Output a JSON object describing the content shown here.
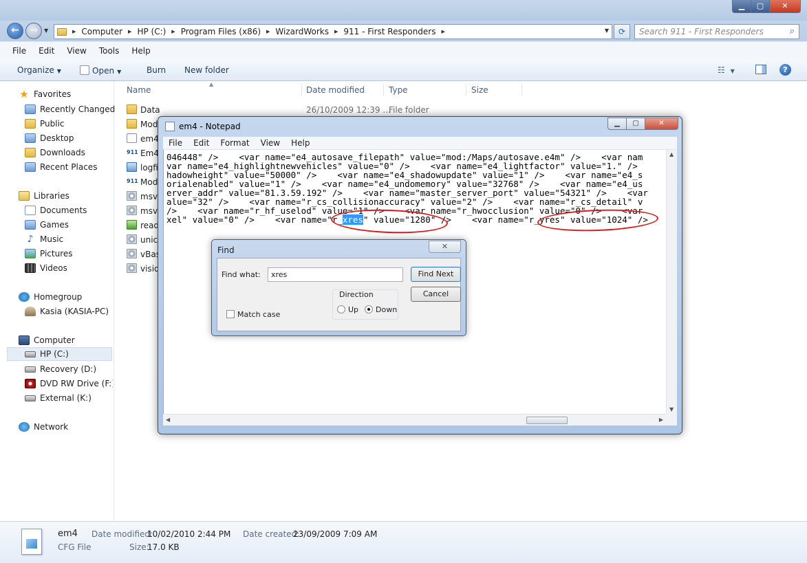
{
  "explorer": {
    "breadcrumbs": [
      "Computer",
      "HP (C:)",
      "Program Files (x86)",
      "WizardWorks",
      "911 - First Responders"
    ],
    "search_placeholder": "Search 911 - First Responders",
    "menu": [
      "File",
      "Edit",
      "View",
      "Tools",
      "Help"
    ],
    "toolbar": {
      "organize": "Organize",
      "open": "Open",
      "burn": "Burn",
      "new_folder": "New folder"
    },
    "nav": {
      "favorites": "Favorites",
      "fav_items": [
        "Recently Changed",
        "Public",
        "Desktop",
        "Downloads",
        "Recent Places"
      ],
      "libraries": "Libraries",
      "lib_items": [
        "Documents",
        "Games",
        "Music",
        "Pictures",
        "Videos"
      ],
      "homegroup": "Homegroup",
      "home_user": "Kasia (KASIA-PC)",
      "computer": "Computer",
      "drives": [
        "HP (C:)",
        "Recovery (D:)",
        "DVD RW Drive (F:) C",
        "External (K:)"
      ],
      "network": "Network"
    },
    "columns": {
      "name": "Name",
      "date": "Date modified",
      "type": "Type",
      "size": "Size"
    },
    "files": [
      {
        "name": "Data",
        "date": "26/10/2009 12:39 ...",
        "type": "File folder"
      },
      {
        "name": "Mod",
        "date": "",
        "type": ""
      },
      {
        "name": "em4",
        "date": "",
        "type": ""
      },
      {
        "name": "Em4",
        "date": "",
        "type": ""
      },
      {
        "name": "logfi",
        "date": "",
        "type": ""
      },
      {
        "name": "Mod",
        "date": "",
        "type": ""
      },
      {
        "name": "msvc",
        "date": "",
        "type": ""
      },
      {
        "name": "msvc",
        "date": "",
        "type": ""
      },
      {
        "name": "read",
        "date": "",
        "type": ""
      },
      {
        "name": "unic",
        "date": "",
        "type": ""
      },
      {
        "name": "vBas",
        "date": "",
        "type": ""
      },
      {
        "name": "visio",
        "date": "",
        "type": ""
      }
    ],
    "details": {
      "name": "em4",
      "type": "CFG File",
      "modified_label": "Date modified:",
      "modified": "10/02/2010 2:44 PM",
      "created_label": "Date created:",
      "created": "23/09/2009 7:09 AM",
      "size_label": "Size:",
      "size": "17.0 KB"
    }
  },
  "notepad": {
    "title": "em4 - Notepad",
    "menu": [
      "File",
      "Edit",
      "Format",
      "View",
      "Help"
    ],
    "lines": [
      "046448\" />    <var name=\"e4_autosave_filepath\" value=\"mod:/Maps/autosave.e4m\" />    <var nam",
      "var name=\"e4_highlightnewvehicles\" value=\"0\" />    <var name=\"e4_lightfactor\" value=\"1.\" />",
      "hadowheight\" value=\"50000\" />    <var name=\"e4_shadowupdate\" value=\"1\" />    <var name=\"e4_s",
      "orialenabled\" value=\"1\" />    <var name=\"e4_undomemory\" value=\"32768\" />    <var name=\"e4_us",
      "erver_addr\" value=\"81.3.59.192\" />    <var name=\"master_server_port\" value=\"54321\" />    <var",
      "alue=\"32\" />    <var name=\"r_cs_collisionaccuracy\" value=\"2\" />    <var name=\"r_cs_detail\" v",
      "/>    <var name=\"r_hf_uselod\" value=\"1\" />    <var name=\"r_hwocclusion\" value=\"0\" />    <var"
    ],
    "last_line": {
      "before": "xel\" value=\"0\" />    <var name=\"r_",
      "selected": "xres",
      "after": "\" value=\"1280\" />    <var name=\"r_yres\" value=\"1024\" />"
    }
  },
  "find_dialog": {
    "title": "Find",
    "find_what_label": "Find what:",
    "find_what_value": "xres",
    "find_next": "Find Next",
    "cancel": "Cancel",
    "direction_label": "Direction",
    "up": "Up",
    "down": "Down",
    "match_case": "Match case"
  }
}
